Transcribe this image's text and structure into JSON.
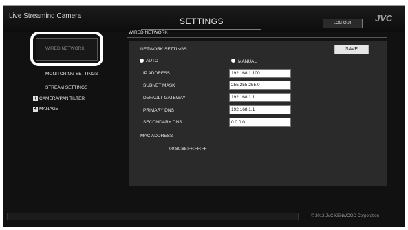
{
  "header": {
    "app_title": "Live Streaming Camera",
    "page_title": "SETTINGS",
    "logout_label": "LOG OUT",
    "brand": "JVC"
  },
  "sidebar": {
    "items": [
      {
        "label": "WIRED NETWORK",
        "selected": true
      },
      {
        "label": "MONITORING SETTINGS"
      },
      {
        "label": "STREAM SETTINGS"
      },
      {
        "label": "CAMERA/PAN TILTER",
        "expandable": true,
        "icon": "plus-icon"
      },
      {
        "label": "MANAGE",
        "expandable": true,
        "icon": "plus-icon"
      }
    ]
  },
  "main": {
    "section_title": "WIRED NETWORK",
    "network_settings_label": "NETWORK SETTINGS",
    "save_label": "SAVE",
    "mode": {
      "auto_label": "AUTO",
      "manual_label": "MANUAL",
      "selected": "MANUAL"
    },
    "fields": [
      {
        "label": "IP ADDRESS",
        "value": "192.168.1.100"
      },
      {
        "label": "SUBNET MASK",
        "value": "255.255.255.0"
      },
      {
        "label": "DEFAULT GATEWAY",
        "value": "192.168.1.1"
      },
      {
        "label": "PRIMARY DNS",
        "value": "192.168.1.1"
      },
      {
        "label": "SECONDARY DNS",
        "value": "0.0.0.0"
      }
    ],
    "mac_label": "MAC ADDRESS",
    "mac_value": "00:80:88:FF:FF:FF"
  },
  "footer": {
    "copyright": "© 2012 JVC KENWOOD Corporation"
  },
  "colors": {
    "background": "#111111",
    "panel": "#2a2a2a",
    "highlight": "#ffffff"
  }
}
